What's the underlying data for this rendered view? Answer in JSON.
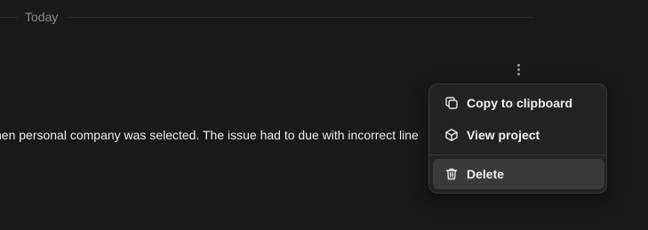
{
  "section": {
    "label": "Today"
  },
  "entry": {
    "text": "hen personal company was selected. The issue had to due with incorrect line"
  },
  "more_menu_icon": "more-vertical-icon",
  "context_menu": {
    "items": [
      {
        "label": "Copy to clipboard",
        "icon": "copy-icon"
      },
      {
        "label": "View project",
        "icon": "cube-icon"
      },
      {
        "label": "Delete",
        "icon": "trash-icon",
        "highlighted": true
      }
    ]
  },
  "colors": {
    "background": "#191919",
    "menu_background": "#232325",
    "menu_highlight": "#3a3a3c",
    "muted_text": "#8b8b8e",
    "primary_text": "#ececec"
  }
}
